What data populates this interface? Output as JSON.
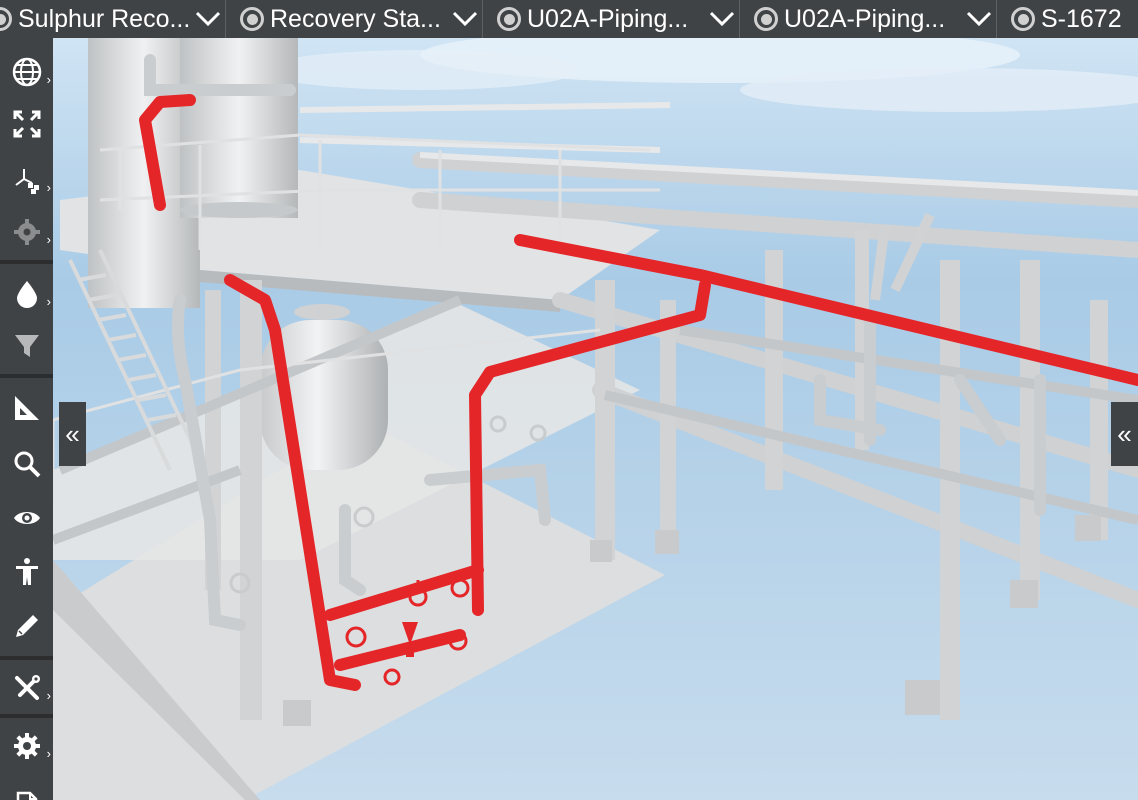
{
  "breadcrumbs": [
    {
      "label": "Sulphur Reco..."
    },
    {
      "label": "Recovery Sta..."
    },
    {
      "label": "U02A-Piping..."
    },
    {
      "label": "U02A-Piping..."
    },
    {
      "label": "S-1672"
    }
  ],
  "toolbar": {
    "tools": [
      {
        "name": "globe-icon",
        "has_submenu": true
      },
      {
        "name": "fullscreen-icon",
        "has_submenu": false
      },
      {
        "name": "axes-icon",
        "has_submenu": true
      },
      {
        "name": "gear-icon",
        "has_submenu": true
      },
      {
        "name": "droplet-icon",
        "has_submenu": true
      },
      {
        "name": "filter-icon",
        "has_submenu": false
      },
      {
        "name": "ruler-icon",
        "has_submenu": false
      },
      {
        "name": "search-icon",
        "has_submenu": false
      },
      {
        "name": "eye-icon",
        "has_submenu": false
      },
      {
        "name": "person-icon",
        "has_submenu": false
      },
      {
        "name": "pencil-icon",
        "has_submenu": false
      },
      {
        "name": "tools-icon",
        "has_submenu": true
      },
      {
        "name": "settings-icon",
        "has_submenu": true
      },
      {
        "name": "document-icon",
        "has_submenu": false
      }
    ],
    "submenu_glyph": "›"
  },
  "handles": {
    "left_glyph": "«",
    "right_glyph": "«"
  },
  "colors": {
    "bar_bg": "#404346",
    "highlight_pipe": "#e52629",
    "model_grey": "#d4d6d8",
    "sky": "#b9d3ea"
  }
}
